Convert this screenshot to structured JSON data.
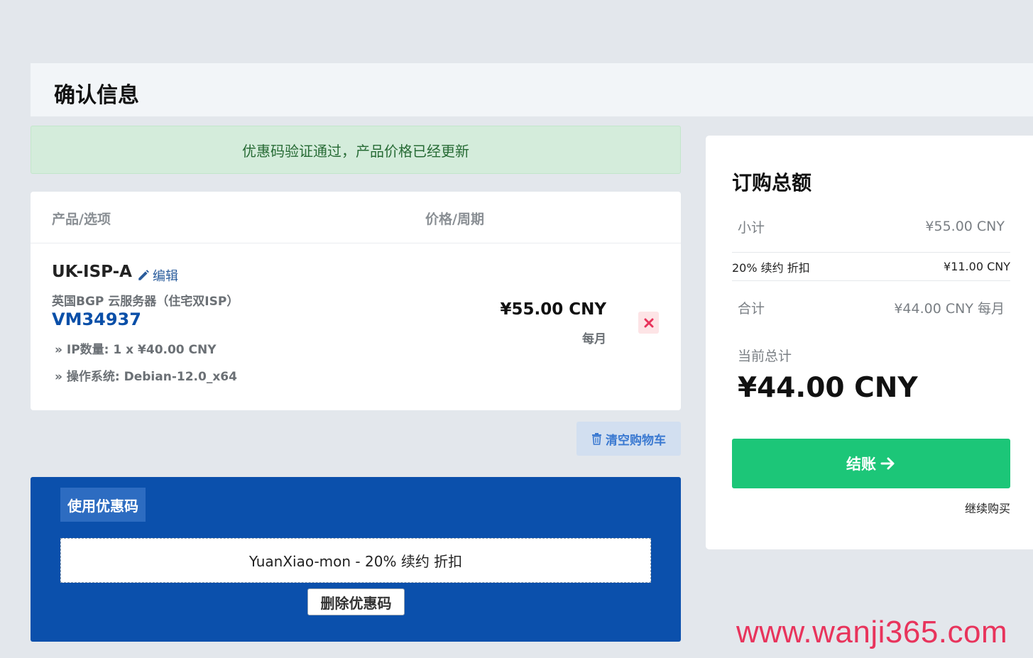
{
  "page": {
    "title": "确认信息"
  },
  "alert": {
    "message": "优惠码验证通过，产品价格已经更新"
  },
  "cart": {
    "headers": {
      "product": "产品/选项",
      "price": "价格/周期"
    },
    "item": {
      "name": "UK-ISP-A",
      "edit_label": "编辑",
      "group": "英国BGP 云服务器（住宅双ISP）",
      "hostname": "VM34937",
      "options": [
        "» IP数量: 1 x ¥40.00 CNY",
        "» 操作系统: Debian-12.0_x64"
      ],
      "price": "¥55.00 CNY",
      "cycle": "每月"
    },
    "empty_label": "清空购物车"
  },
  "promo": {
    "title": "使用优惠码",
    "applied_code": "YuanXiao-mon - 20% 续约 折扣",
    "remove_label": "删除优惠码"
  },
  "summary": {
    "title": "订购总额",
    "subtotal_label": "小计",
    "subtotal_value": "¥55.00 CNY",
    "discount_label": "20% 续约 折扣",
    "discount_value": "¥11.00 CNY",
    "total_label": "合计",
    "total_value": "¥44.00 CNY 每月",
    "today_label": "当前总计",
    "today_amount": "¥44.00 CNY",
    "checkout_label": "结账",
    "continue_label": "继续购买"
  },
  "watermark": "www.wanji365.com",
  "colors": {
    "primary_blue": "#0b50ac",
    "success_green": "#1cc678",
    "alert_bg": "#d4ecdb",
    "remove_red": "#e8345c"
  }
}
